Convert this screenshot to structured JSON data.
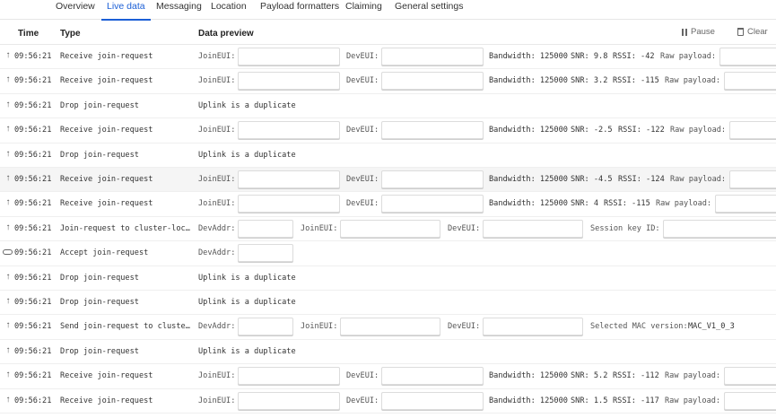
{
  "tabs": [
    "Overview",
    "Live data",
    "Messaging",
    "Location",
    "Payload formatters",
    "Claiming",
    "General settings"
  ],
  "active_tab": "Live data",
  "table": {
    "col_time": "Time",
    "col_type": "Type",
    "col_preview": "Data preview",
    "pause_label": "Pause",
    "clear_label": "Clear"
  },
  "labels": {
    "join_eui": "JoinEUI:",
    "dev_eui": "DevEUI:",
    "dev_addr": "DevAddr:",
    "session_key_id": "Session key ID:",
    "selected_mac": "Selected MAC version:",
    "mac_version": "MAC_V1_0_3",
    "bandwidth": "Bandwidth: 125000",
    "raw_payload": "Raw payload:",
    "duplicate": "Uplink is a duplicate"
  },
  "events": [
    {
      "icon": "arrow-up-icon",
      "time": "09:56:21",
      "type": "Receive join-request",
      "kind": "receive",
      "snr": "SNR: 9.8",
      "rssi": "RSSI: -42",
      "highlight": false
    },
    {
      "icon": "arrow-up-icon",
      "time": "09:56:21",
      "type": "Receive join-request",
      "kind": "receive",
      "snr": "SNR: 3.2",
      "rssi": "RSSI: -115",
      "highlight": false
    },
    {
      "icon": "arrow-up-icon",
      "time": "09:56:21",
      "type": "Drop join-request",
      "kind": "drop",
      "highlight": false
    },
    {
      "icon": "arrow-up-icon",
      "time": "09:56:21",
      "type": "Receive join-request",
      "kind": "receive",
      "snr": "SNR: -2.5",
      "rssi": "RSSI: -122",
      "highlight": false
    },
    {
      "icon": "arrow-up-icon",
      "time": "09:56:21",
      "type": "Drop join-request",
      "kind": "drop",
      "highlight": false
    },
    {
      "icon": "arrow-up-icon",
      "time": "09:56:21",
      "type": "Receive join-request",
      "kind": "receive",
      "snr": "SNR: -4.5",
      "rssi": "RSSI: -124",
      "highlight": true
    },
    {
      "icon": "arrow-up-icon",
      "time": "09:56:21",
      "type": "Receive join-request",
      "kind": "receive",
      "snr": "SNR: 4",
      "rssi": "RSSI: -115",
      "highlight": false
    },
    {
      "icon": "arrow-up-icon",
      "time": "09:56:21",
      "type": "Join-request to cluster-loca…",
      "kind": "session",
      "highlight": false
    },
    {
      "icon": "link-icon",
      "time": "09:56:21",
      "type": "Accept join-request",
      "kind": "accept",
      "highlight": false
    },
    {
      "icon": "arrow-up-icon",
      "time": "09:56:21",
      "type": "Drop join-request",
      "kind": "drop",
      "highlight": false
    },
    {
      "icon": "arrow-up-icon",
      "time": "09:56:21",
      "type": "Drop join-request",
      "kind": "drop",
      "highlight": false
    },
    {
      "icon": "arrow-up-icon",
      "time": "09:56:21",
      "type": "Send join-request to cluster…",
      "kind": "send",
      "highlight": false
    },
    {
      "icon": "arrow-up-icon",
      "time": "09:56:21",
      "type": "Drop join-request",
      "kind": "drop",
      "highlight": false
    },
    {
      "icon": "arrow-up-icon",
      "time": "09:56:21",
      "type": "Receive join-request",
      "kind": "receive",
      "snr": "SNR: 5.2",
      "rssi": "RSSI: -112",
      "highlight": false
    },
    {
      "icon": "arrow-up-icon",
      "time": "09:56:21",
      "type": "Receive join-request",
      "kind": "receive",
      "snr": "SNR: 1.5",
      "rssi": "RSSI: -117",
      "highlight": false
    }
  ]
}
